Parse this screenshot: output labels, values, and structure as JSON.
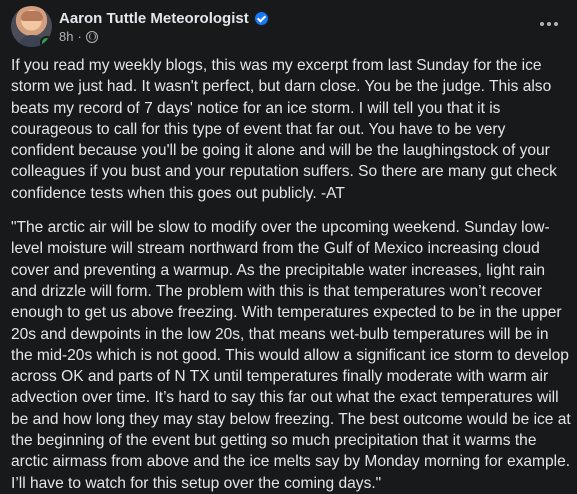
{
  "post": {
    "author": {
      "name": "Aaron Tuttle Meteorologist",
      "verified": true,
      "time_ago": "8h",
      "separator": "·",
      "audience_icon": "globe-icon"
    },
    "actions": {
      "more_icon": "more-options-icon"
    },
    "paragraphs": [
      "If you read my weekly blogs, this was my excerpt from last Sunday for the ice storm we just had. It wasn't perfect, but darn close. You be the judge. This also beats my record of 7 days' notice for an ice storm. I will tell you that it is courageous to call for this type of event that far out. You have to be very confident because you'll be going it alone and will be the laughingstock of your colleagues if you bust and your reputation suffers. So there are many gut check confidence tests when this goes out publicly. -AT",
      "\"The arctic air will be slow to modify over the upcoming weekend. Sunday low-level moisture will stream northward from the Gulf of Mexico increasing cloud cover and preventing a warmup. As the precipitable water increases, light rain and drizzle will form. The problem with this is that temperatures won’t recover enough to get us above freezing. With temperatures expected to be in the upper 20s and dewpoints in the low 20s, that means wet-bulb temperatures will be in the mid-20s which is not good. This would allow a significant ice storm to develop across OK and parts of N TX until temperatures finally moderate with warm air advection over time. It’s hard to say this far out what the exact temperatures will be and how long they may stay below freezing. The best outcome would be ice at the beginning of the event but getting so much precipitation that it warms the arctic airmass from above and the ice melts say by Monday morning for example. I’ll have to watch for this setup over the coming days.\""
    ]
  },
  "colors": {
    "background": "#18191a",
    "primary_text": "#e4e6eb",
    "secondary_text": "#b0b3b8",
    "verified": "#1877f2",
    "online": "#31a24c"
  }
}
